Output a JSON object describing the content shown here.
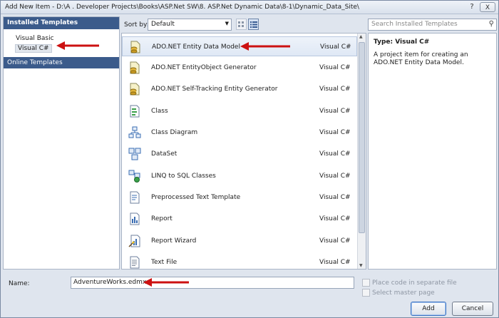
{
  "window": {
    "title": "Add New Item - D:\\A . Developer Projects\\Books\\ASP.Net SW\\8. ASP.Net Dynamic Data\\8-1\\Dynamic_Data_Site\\",
    "help_label": "?",
    "close_label": "X"
  },
  "left": {
    "installed_header": "Installed Templates",
    "items": [
      {
        "label": "Visual Basic",
        "selected": false
      },
      {
        "label": "Visual C#",
        "selected": true
      }
    ],
    "online_label": "Online Templates"
  },
  "toolbar": {
    "sort_label": "Sort by:",
    "sort_value": "Default",
    "search_placeholder": "Search Installed Templates"
  },
  "templates": [
    {
      "name": "ADO.NET Entity Data Model",
      "lang": "Visual C#",
      "icon": "entity-model-icon",
      "selected": true
    },
    {
      "name": "ADO.NET EntityObject Generator",
      "lang": "Visual C#",
      "icon": "entity-generator-icon",
      "selected": false
    },
    {
      "name": "ADO.NET Self-Tracking Entity Generator",
      "lang": "Visual C#",
      "icon": "self-tracking-generator-icon",
      "selected": false
    },
    {
      "name": "Class",
      "lang": "Visual C#",
      "icon": "class-icon",
      "selected": false
    },
    {
      "name": "Class Diagram",
      "lang": "Visual C#",
      "icon": "class-diagram-icon",
      "selected": false
    },
    {
      "name": "DataSet",
      "lang": "Visual C#",
      "icon": "dataset-icon",
      "selected": false
    },
    {
      "name": "LINQ to SQL Classes",
      "lang": "Visual C#",
      "icon": "linq-sql-icon",
      "selected": false
    },
    {
      "name": "Preprocessed Text Template",
      "lang": "Visual C#",
      "icon": "text-template-icon",
      "selected": false
    },
    {
      "name": "Report",
      "lang": "Visual C#",
      "icon": "report-icon",
      "selected": false
    },
    {
      "name": "Report Wizard",
      "lang": "Visual C#",
      "icon": "report-wizard-icon",
      "selected": false
    },
    {
      "name": "Text File",
      "lang": "Visual C#",
      "icon": "text-file-icon",
      "selected": false
    }
  ],
  "details": {
    "type_line": "Type:  Visual C#",
    "description": "A project item for creating an ADO.NET Entity Data Model."
  },
  "bottom": {
    "name_label": "Name:",
    "name_value": "AdventureWorks.edmx",
    "place_code_label": "Place code in separate file",
    "select_master_label": "Select master page",
    "add_label": "Add",
    "cancel_label": "Cancel"
  },
  "colors": {
    "header_blue": "#3b5b8b",
    "annotation_red": "#cc1111"
  }
}
